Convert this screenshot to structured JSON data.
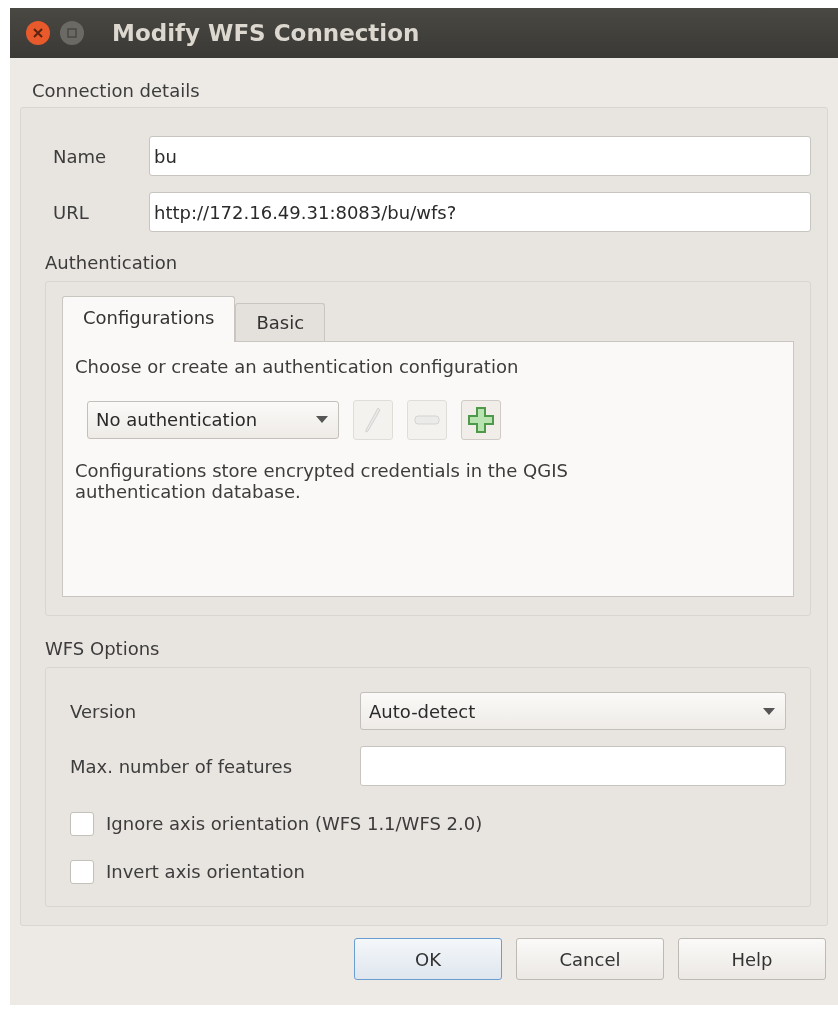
{
  "window": {
    "title": "Modify WFS Connection"
  },
  "connection_details": {
    "title": "Connection details",
    "fields": [
      {
        "label": "Name",
        "value": "bu"
      },
      {
        "label": "URL",
        "value": "http://172.16.49.31:8083/bu/wfs?"
      }
    ]
  },
  "authentication": {
    "title": "Authentication",
    "tabs": [
      {
        "label": "Configurations",
        "selected": true
      },
      {
        "label": "Basic",
        "selected": false
      }
    ],
    "prompt": "Choose or create an authentication configuration",
    "config_select": {
      "value": "No authentication"
    },
    "tool_buttons": [
      {
        "kind": "edit",
        "disabled": true
      },
      {
        "kind": "remove",
        "disabled": true
      },
      {
        "kind": "add",
        "disabled": false
      }
    ],
    "note": "Configurations store encrypted credentials in the QGIS authentication database."
  },
  "wfs_options": {
    "title": "WFS Options",
    "version": {
      "label": "Version",
      "value": "Auto-detect"
    },
    "max_features": {
      "label": "Max. number of features"
    },
    "checkboxes": [
      {
        "label": "Ignore axis orientation (WFS 1.1/WFS 2.0)",
        "checked": false
      },
      {
        "label": "Invert axis orientation",
        "checked": false
      }
    ]
  },
  "buttons": [
    {
      "label": "OK",
      "default": true
    },
    {
      "label": "Cancel",
      "default": false
    },
    {
      "label": "Help",
      "default": false
    }
  ]
}
